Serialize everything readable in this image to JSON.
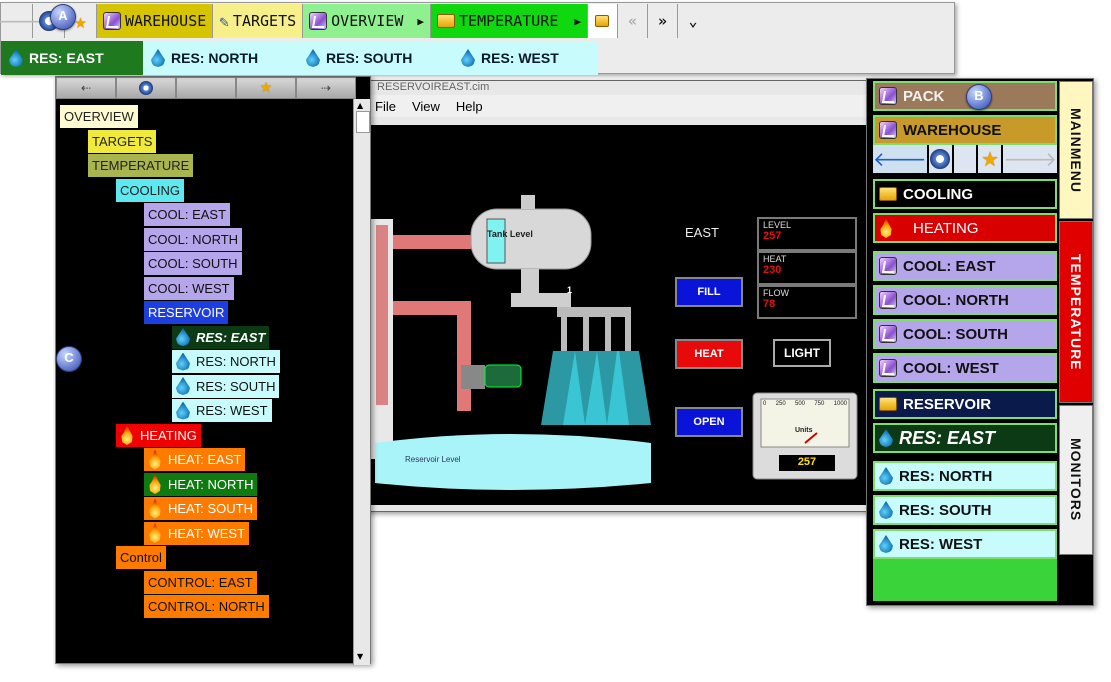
{
  "topbar": {
    "row1": [
      {
        "label": "WAREHOUSE",
        "bg": "#d6c400",
        "icon": "flask-icon"
      },
      {
        "label": "TARGETS",
        "bg": "#f7ef8a",
        "icon": "edit-icon"
      },
      {
        "label": "OVERVIEW",
        "bg": "#8ef08e",
        "icon": "flask-icon"
      },
      {
        "label": "TEMPERATURE",
        "bg": "#0fd80f",
        "icon": "folder-icon"
      }
    ],
    "row2": [
      {
        "label": "RES: EAST",
        "bg": "#1f7a1f",
        "color": "#ffffff"
      },
      {
        "label": "RES: NORTH",
        "bg": "#c8fbfb",
        "color": "#0a1a2a"
      },
      {
        "label": "RES: SOUTH",
        "bg": "#c8fbfb",
        "color": "#0a1a2a"
      },
      {
        "label": "RES: WEST",
        "bg": "#c8fbfb",
        "color": "#0a1a2a"
      }
    ],
    "nav_prev": "«",
    "nav_next": "»",
    "nav_menu": "⌄"
  },
  "callouts": {
    "a": "A",
    "b": "B",
    "c": "C"
  },
  "tree": {
    "items": [
      {
        "label": "OVERVIEW",
        "bg": "#fffbd0",
        "color": "#222222",
        "indent": 0,
        "icon": ""
      },
      {
        "label": "TARGETS",
        "bg": "#f2ea3a",
        "color": "#222222",
        "indent": 1,
        "icon": ""
      },
      {
        "label": "TEMPERATURE",
        "bg": "#a9b54e",
        "color": "#222222",
        "indent": 1,
        "icon": ""
      },
      {
        "label": "COOLING",
        "bg": "#5ee8ef",
        "color": "#222222",
        "indent": 2,
        "icon": ""
      },
      {
        "label": "COOL: EAST",
        "bg": "#b5a5ea",
        "color": "#111111",
        "indent": 3,
        "icon": ""
      },
      {
        "label": "COOL: NORTH",
        "bg": "#b5a5ea",
        "color": "#111111",
        "indent": 3,
        "icon": ""
      },
      {
        "label": "COOL: SOUTH",
        "bg": "#b5a5ea",
        "color": "#111111",
        "indent": 3,
        "icon": ""
      },
      {
        "label": "COOL: WEST",
        "bg": "#b5a5ea",
        "color": "#111111",
        "indent": 3,
        "icon": ""
      },
      {
        "label": "RESERVOIR",
        "bg": "#1d3fe0",
        "color": "#ffffff",
        "indent": 3,
        "icon": ""
      },
      {
        "label": "RES: EAST",
        "bg": "#0c3a14",
        "color": "#ffffff",
        "indent": 4,
        "icon": "drop",
        "italic": true
      },
      {
        "label": "RES: NORTH",
        "bg": "#c8fbfb",
        "color": "#111111",
        "indent": 4,
        "icon": "drop"
      },
      {
        "label": "RES: SOUTH",
        "bg": "#c8fbfb",
        "color": "#111111",
        "indent": 4,
        "icon": "drop"
      },
      {
        "label": "RES: WEST",
        "bg": "#c8fbfb",
        "color": "#111111",
        "indent": 4,
        "icon": "drop"
      },
      {
        "label": "HEATING",
        "bg": "#f00000",
        "color": "#ffffff",
        "indent": 2,
        "icon": "flame"
      },
      {
        "label": "HEAT: EAST",
        "bg": "#ff7b00",
        "color": "#ffffff",
        "indent": 3,
        "icon": "flame"
      },
      {
        "label": "HEAT: NORTH",
        "bg": "#0f7a0f",
        "color": "#ffffff",
        "indent": 3,
        "icon": "flame"
      },
      {
        "label": "HEAT: SOUTH",
        "bg": "#ff7b00",
        "color": "#ffffff",
        "indent": 3,
        "icon": "flame"
      },
      {
        "label": "HEAT: WEST",
        "bg": "#ff7b00",
        "color": "#ffffff",
        "indent": 3,
        "icon": "flame"
      },
      {
        "label": "Control",
        "bg": "#ff7b00",
        "color": "#111111",
        "indent": 2,
        "icon": ""
      },
      {
        "label": "CONTROL: EAST",
        "bg": "#ff7b00",
        "color": "#111111",
        "indent": 3,
        "icon": ""
      },
      {
        "label": "CONTROL: NORTH",
        "bg": "#ff7b00",
        "color": "#111111",
        "indent": 3,
        "icon": ""
      }
    ]
  },
  "scada": {
    "title": "RESERVOIREAST.cim",
    "menu": [
      "File",
      "View",
      "Help"
    ],
    "site_label": "EAST",
    "tank_label": "Tank Level",
    "reservoir_label": "Reservoir Level",
    "valve_number": "1",
    "buttons": {
      "fill": "FILL",
      "heat": "HEAT",
      "open": "OPEN",
      "light": "LIGHT"
    },
    "readouts": [
      {
        "label": "LEVEL",
        "value": "257"
      },
      {
        "label": "HEAT",
        "value": "230"
      },
      {
        "label": "FLOW",
        "value": "78"
      }
    ],
    "gauge": {
      "ticks": [
        "0",
        "250",
        "500",
        "750",
        "1000"
      ],
      "unit": "Units",
      "value": "257"
    }
  },
  "nav": {
    "items": [
      {
        "label": "PACK",
        "bg": "#9a7a5a",
        "color": "#f0f0f0",
        "icon": "flask"
      },
      {
        "label": "WAREHOUSE",
        "bg": "#c79a2a",
        "color": "#101010",
        "icon": "flask"
      },
      {
        "label": "COOLING",
        "bg": "#000000",
        "color": "#ffffff",
        "icon": "folder"
      },
      {
        "label": "HEATING",
        "bg": "#d80000",
        "color": "#ffffff",
        "icon": "flame"
      },
      {
        "label": "COOL: EAST",
        "bg": "#b5a5ea",
        "color": "#111111",
        "icon": "flask"
      },
      {
        "label": "COOL: NORTH",
        "bg": "#b5a5ea",
        "color": "#111111",
        "icon": "flask"
      },
      {
        "label": "COOL: SOUTH",
        "bg": "#b5a5ea",
        "color": "#111111",
        "icon": "flask"
      },
      {
        "label": "COOL: WEST",
        "bg": "#b5a5ea",
        "color": "#111111",
        "icon": "flask"
      },
      {
        "label": "RESERVOIR",
        "bg": "#0a1a4a",
        "color": "#ffffff",
        "icon": "folder"
      },
      {
        "label": "RES: EAST",
        "bg": "#0c3a14",
        "color": "#ffffff",
        "icon": "drop",
        "italic": true
      },
      {
        "label": "RES: NORTH",
        "bg": "#c8fbfb",
        "color": "#111111",
        "icon": "drop"
      },
      {
        "label": "RES: SOUTH",
        "bg": "#c8fbfb",
        "color": "#111111",
        "icon": "drop"
      },
      {
        "label": "RES: WEST",
        "bg": "#c8fbfb",
        "color": "#111111",
        "icon": "drop"
      }
    ],
    "vtabs": [
      "MAINMENU",
      "TEMPERATURE",
      "MONITORS"
    ]
  },
  "colors": {
    "green_fill": "#3ad43a",
    "nav_border": "#7fdc6f"
  }
}
